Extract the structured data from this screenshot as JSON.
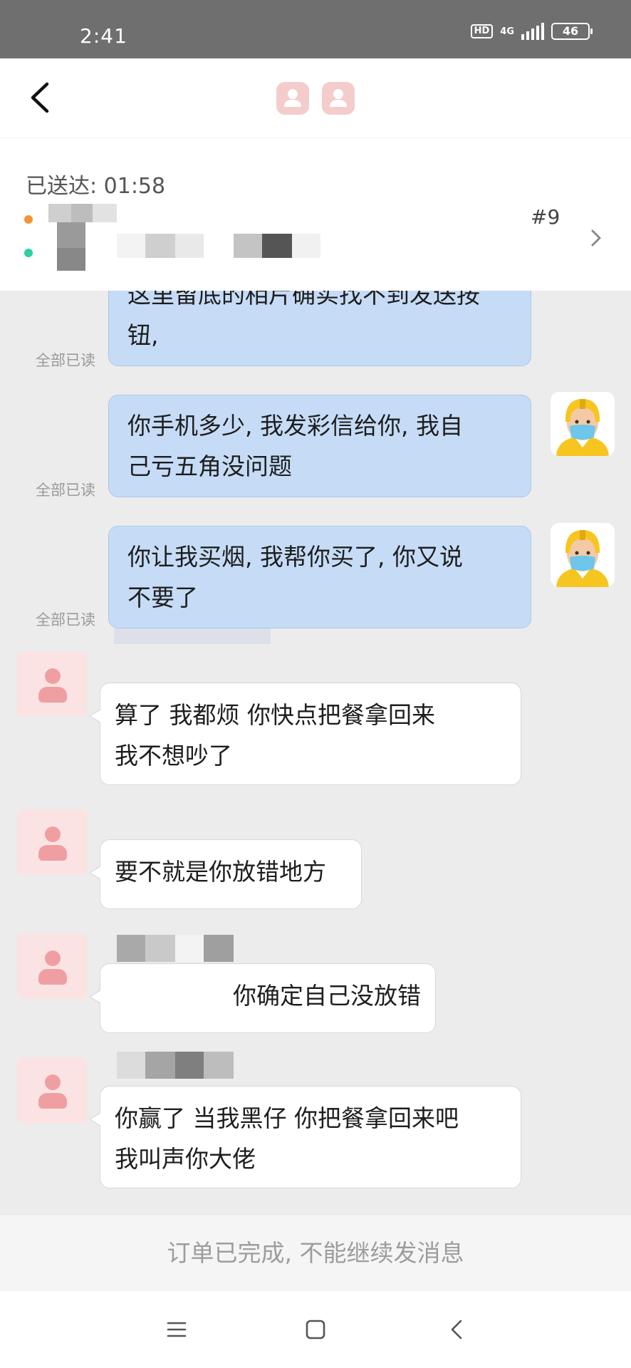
{
  "status_bar": {
    "time": "2:41",
    "hd": "HD",
    "network": "4G",
    "battery": "46"
  },
  "header": {
    "back_icon": "chevron-left-icon",
    "avatar_icon": "user-icon"
  },
  "order": {
    "delivered_label": "已送达: 01:58",
    "order_number": "#9",
    "chevron_icon": "chevron-right-icon",
    "colors": {
      "orange_dot": "#f39437",
      "green_dot": "#2fd0a0"
    }
  },
  "messages": [
    {
      "side": "out",
      "text_lines": [
        "这里留底的相片确实找不到发送按",
        "钮,"
      ],
      "status": "全部已读"
    },
    {
      "side": "out",
      "text_lines": [
        "你手机多少, 我发彩信给你, 我自",
        "己亏五角没问题"
      ],
      "status": "全部已读"
    },
    {
      "side": "out",
      "text_lines": [
        "你让我买烟, 我帮你买了, 你又说",
        "不要了"
      ],
      "status": "全部已读"
    },
    {
      "side": "in",
      "text_lines": [
        "算了 我都烦  你快点把餐拿回来",
        "我不想吵了"
      ]
    },
    {
      "side": "in",
      "text_lines": [
        "要不就是你放错地方"
      ]
    },
    {
      "side": "in",
      "text_lines": [
        "你确定自己没放错"
      ]
    },
    {
      "side": "in",
      "text_lines": [
        "你赢了  当我黑仔  你把餐拿回来吧",
        "我叫声你大佬"
      ]
    }
  ],
  "footer": {
    "notice": "订单已完成, 不能继续发消息"
  },
  "nav": {
    "menu_icon": "menu-icon",
    "home_icon": "home-square-icon",
    "back_icon": "back-triangle-icon"
  },
  "theme": {
    "outgoing_bubble": "#c6dcf6",
    "incoming_bubble": "#ffffff",
    "background": "#ececec"
  }
}
